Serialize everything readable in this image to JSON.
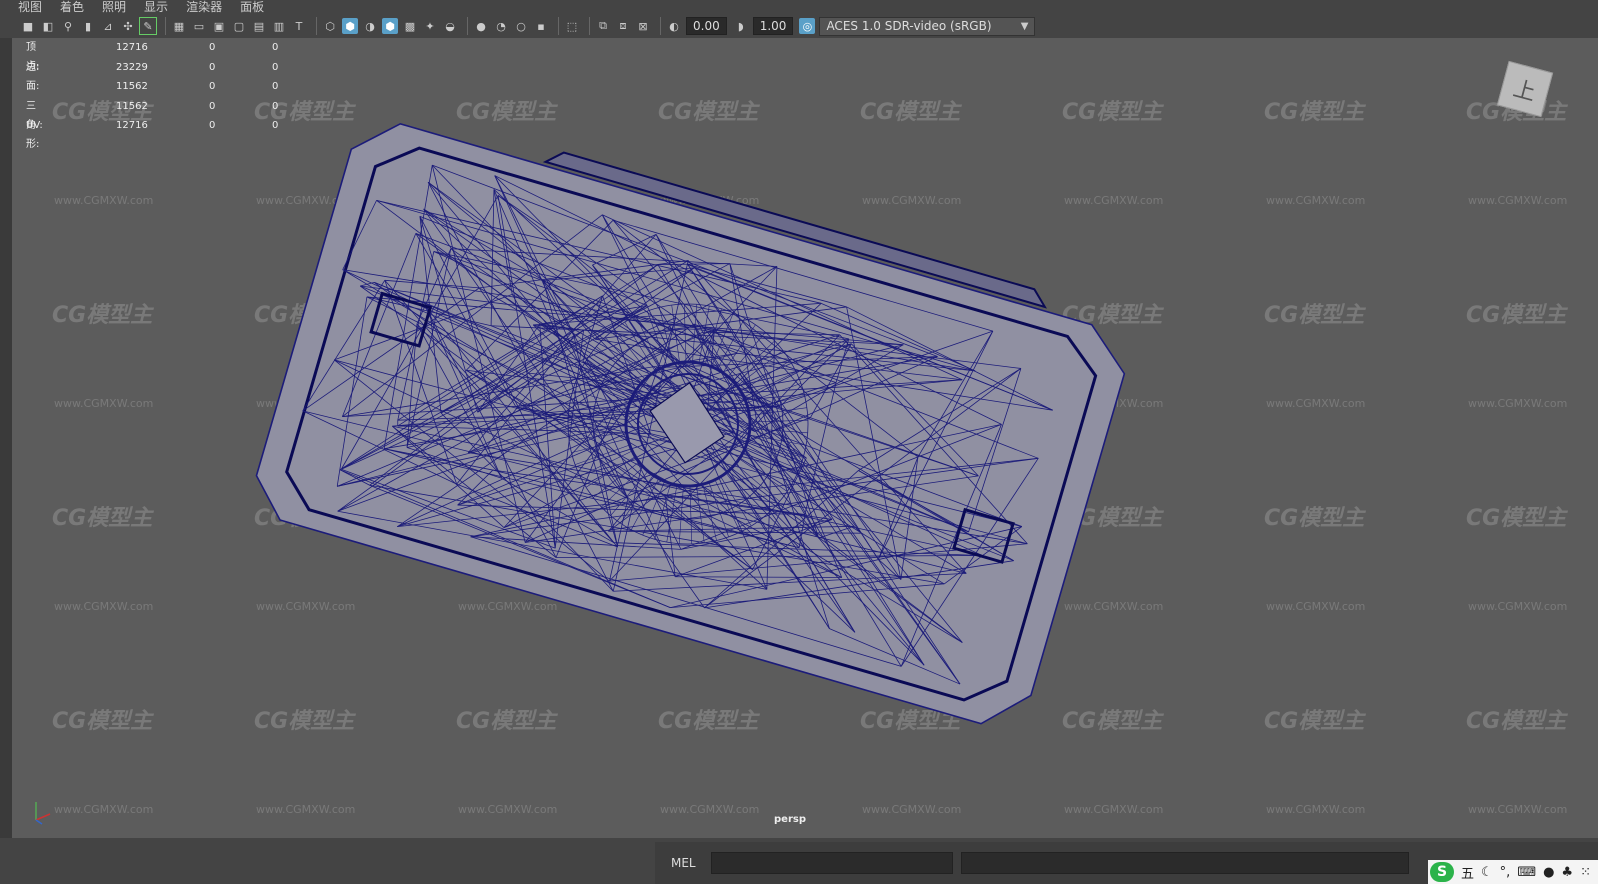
{
  "menu": [
    "视图",
    "着色",
    "照明",
    "显示",
    "渲染器",
    "面板"
  ],
  "toolbar": {
    "icons": [
      "camera-icon",
      "camera-attr-icon",
      "bookmark-icon",
      "image-plane-icon",
      "grid-icon",
      "film-gate-icon",
      "resolution-gate-icon",
      "field-chart-icon",
      "safe-action-icon",
      "safe-title-icon",
      "wireframe-icon",
      "smooth-shade-icon",
      "default-material-icon",
      "textured-icon",
      "use-all-lights-icon",
      "shadows-icon",
      "ambient-occlusion-icon",
      "motion-blur-icon",
      "multisample-icon",
      "xray-icon",
      "xray-joints-icon",
      "isolate-select-icon",
      "exposure-icon"
    ],
    "exposure_value": "0.00",
    "gamma_value": "1.00",
    "color_space": "ACES 1.0 SDR-video (sRGB)"
  },
  "hud": {
    "rows": [
      {
        "label": "顶点:",
        "v1": "12716",
        "v2": "0",
        "v3": "0"
      },
      {
        "label": "边:",
        "v1": "23229",
        "v2": "0",
        "v3": "0"
      },
      {
        "label": "面:",
        "v1": "11562",
        "v2": "0",
        "v3": "0"
      },
      {
        "label": "三角形:",
        "v1": "11562",
        "v2": "0",
        "v3": "0"
      },
      {
        "label": "UV:",
        "v1": "12716",
        "v2": "0",
        "v3": "0"
      }
    ]
  },
  "viewcube_label": "上",
  "camera_label": "persp",
  "watermark": {
    "logo": "CG模型主",
    "url": "www.CGMXW.com"
  },
  "command_line": {
    "label": "MEL"
  },
  "ime": {
    "logo": "S",
    "mode": "五"
  },
  "colors": {
    "wire": "#1c1c7a",
    "mesh_fill": "#9090a2",
    "viewport_bg": "#5c5c5c"
  }
}
